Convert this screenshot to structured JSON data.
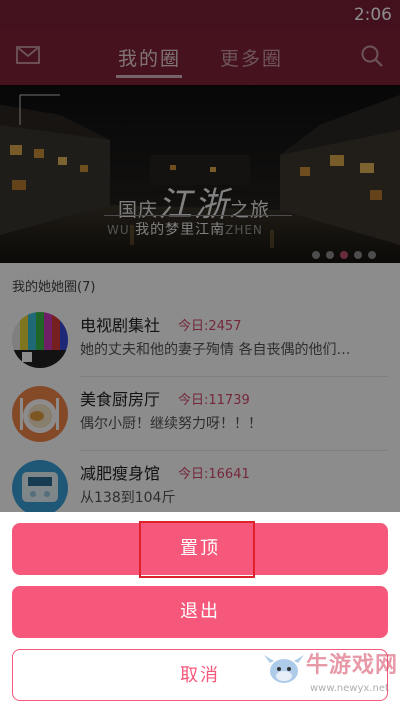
{
  "status_bar": {
    "time": "2:06"
  },
  "header": {
    "tabs": [
      {
        "label": "我的圈"
      },
      {
        "label": "更多圈"
      }
    ],
    "active_tab": "我的圈",
    "icons": {
      "left": "mail-icon",
      "right": "search-icon"
    }
  },
  "banner": {
    "title_pre": "国庆",
    "title_big": "江浙",
    "title_post": "之旅",
    "subtitle_tag_left": "WU",
    "subtitle": "我的梦里江南",
    "subtitle_tag_right": "ZHEN",
    "page_count": 5,
    "active_page": 3
  },
  "section": {
    "title": "我的她她圈(7)"
  },
  "groups": [
    {
      "name": "电视剧集社",
      "today": "今日:2457",
      "desc": "她的丈夫和他的妻子殉情 各自丧偶的他们…",
      "avatar": "tv-test-pattern-icon"
    },
    {
      "name": "美食厨房厅",
      "today": "今日:11739",
      "desc": "偶尔小厨！继续努力呀！！！",
      "avatar": "food-plate-icon"
    },
    {
      "name": "减肥瘦身馆",
      "today": "今日:16641",
      "desc": "从138到104斤",
      "avatar": "scale-icon"
    }
  ],
  "sheet": {
    "pin_label": "置顶",
    "exit_label": "退出",
    "cancel_label": "取消"
  },
  "watermark": {
    "text": "牛游戏网",
    "url": "www.newyx.net"
  },
  "colors": {
    "header": "#7e2138",
    "accent": "#f5587a",
    "today_red": "#d44a6a",
    "highlight_box": "#e0202a"
  }
}
